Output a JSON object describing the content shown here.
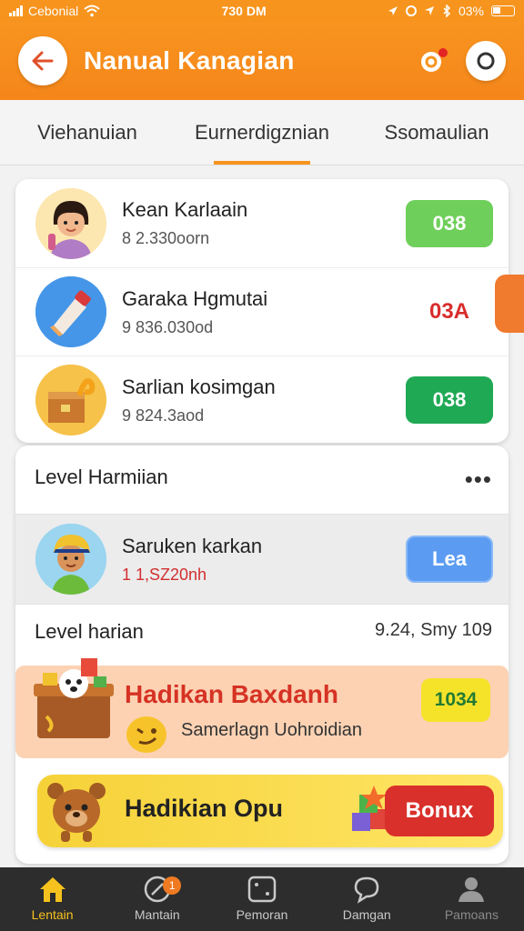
{
  "status_bar": {
    "carrier": "Cebonial",
    "time": "730 DM",
    "battery_text": "03%"
  },
  "header": {
    "title": "Nanual Kanagian"
  },
  "tabs": [
    {
      "label": "Viehanuian",
      "active": false
    },
    {
      "label": "Eurnerdigznian",
      "active": true
    },
    {
      "label": "Ssomaulian",
      "active": false
    }
  ],
  "list": [
    {
      "name": "Kean Karlaain",
      "sub": "8 2.330oorn",
      "button": "038",
      "button_color": "#6fcf5b"
    },
    {
      "name": "Garaka Hgmutai",
      "sub": "9 836.030od",
      "button": "03A",
      "button_color": "#d92d2d"
    },
    {
      "name": "Sarlian kosimgan",
      "sub": "9 824.3aod",
      "button": "038",
      "button_color": "#20a955"
    }
  ],
  "section": {
    "title": "Level Harmiian",
    "more": "•••",
    "user": {
      "name": "Saruken karkan",
      "sub": "1 1,SZ20nh",
      "button": "Lea"
    },
    "level_title": "Level harian",
    "level_meta": "9.24, Smy 109",
    "promo1": {
      "title": "Hadikan Baxdanh",
      "sub": "Samerlagn Uohroidian",
      "badge": "1034"
    },
    "promo2": {
      "title": "Hadikian Opu",
      "button": "Bonux"
    }
  },
  "bottom_nav": [
    {
      "label": "Lentain",
      "icon": "home-icon",
      "active": true
    },
    {
      "label": "Mantain",
      "icon": "clock-icon",
      "active": false,
      "badge": "1"
    },
    {
      "label": "Pemoran",
      "icon": "dice-icon",
      "active": false
    },
    {
      "label": "Damgan",
      "icon": "chat-icon",
      "active": false
    },
    {
      "label": "Pamoans",
      "icon": "profile-icon",
      "active": false
    }
  ]
}
